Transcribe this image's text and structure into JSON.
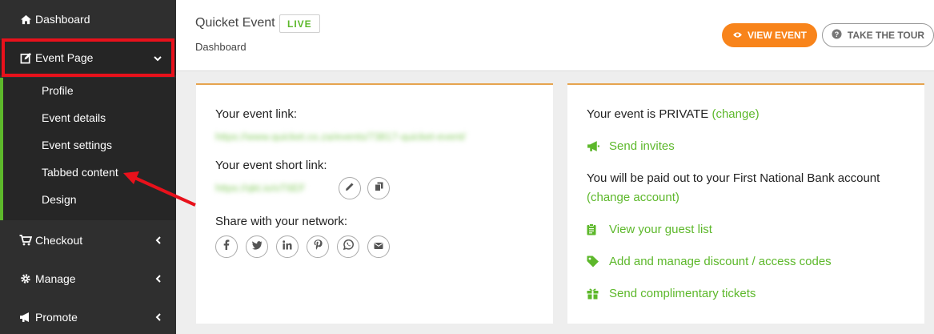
{
  "sidebar": {
    "dashboard": "Dashboard",
    "event_page": "Event Page",
    "submenu": [
      "Profile",
      "Event details",
      "Event settings",
      "Tabbed content",
      "Design"
    ],
    "checkout": "Checkout",
    "manage": "Manage",
    "promote": "Promote"
  },
  "header": {
    "title": "Quicket Event",
    "status_badge": "LIVE",
    "breadcrumb": "Dashboard",
    "view_event": "VIEW EVENT",
    "take_tour": "TAKE THE TOUR"
  },
  "left_card": {
    "event_link_label": "Your event link:",
    "event_link_value": "https://www.quicket.co.za/events/73817-quicket-event/",
    "short_link_label": "Your event short link:",
    "short_link_value": "https://qkt.io/oT6EF",
    "share_label": "Share with your network:",
    "share_icons": [
      "facebook-icon",
      "twitter-icon",
      "linkedin-icon",
      "pinterest-icon",
      "whatsapp-icon",
      "email-icon"
    ]
  },
  "right_card": {
    "privacy_text": "Your event is PRIVATE",
    "privacy_change": "(change)",
    "send_invites": "Send invites",
    "payout_text": "You will be paid out to your First National Bank account",
    "change_account": "(change account)",
    "guest_list": "View your guest list",
    "discount_codes": "Add and manage discount / access codes",
    "complimentary": "Send complimentary tickets"
  },
  "colors": {
    "sidebar_bg": "#2f2f2f",
    "accent_green": "#5db82b",
    "accent_orange": "#f8841b",
    "highlight_red": "#e8111b"
  }
}
